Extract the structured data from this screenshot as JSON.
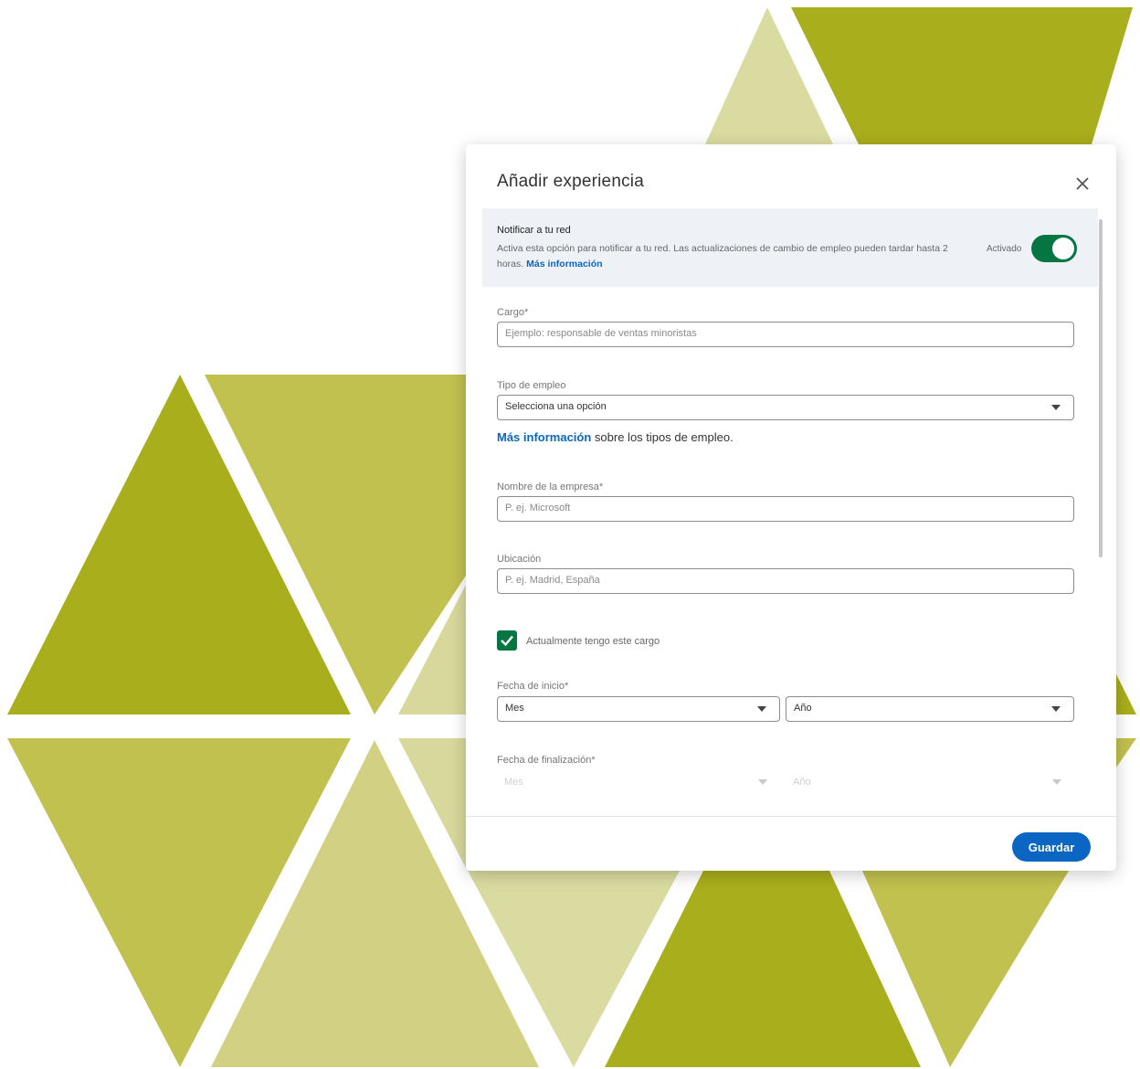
{
  "dialog": {
    "title": "Añadir experiencia",
    "notify": {
      "title": "Notificar a tu red",
      "description": "Activa esta opción para notificar a tu red. Las actualizaciones de cambio de empleo pueden tardar hasta 2 horas.",
      "link": "Más información",
      "toggle_label": "Activado",
      "toggle_on": true
    },
    "fields": {
      "cargo": {
        "label": "Cargo*",
        "placeholder": "Ejemplo: responsable de ventas minoristas"
      },
      "tipo_empleo": {
        "label": "Tipo de empleo",
        "value": "Selecciona una opción"
      },
      "info": {
        "link": "Más información",
        "text": "sobre los tipos de empleo."
      },
      "empresa": {
        "label": "Nombre de la empresa*",
        "placeholder": "P. ej. Microsoft"
      },
      "ubicacion": {
        "label": "Ubicación",
        "placeholder": "P. ej. Madrid, España"
      },
      "cargo_actual": {
        "label": "Actualmente tengo este cargo",
        "checked": true
      },
      "fecha_inicio": {
        "label": "Fecha de inicio*",
        "month": "Mes",
        "year": "Año"
      },
      "fecha_fin": {
        "label": "Fecha de finalización*",
        "month": "Mes",
        "year": "Año"
      }
    },
    "save_label": "Guardar"
  },
  "colors": {
    "accent_blue": "#0a66c2",
    "toggle_green": "#057642",
    "olive_dark": "#a9ae1c",
    "olive_mid": "#c1c14f",
    "olive_light": "#d1d083",
    "olive_pale": "#dadba0"
  }
}
